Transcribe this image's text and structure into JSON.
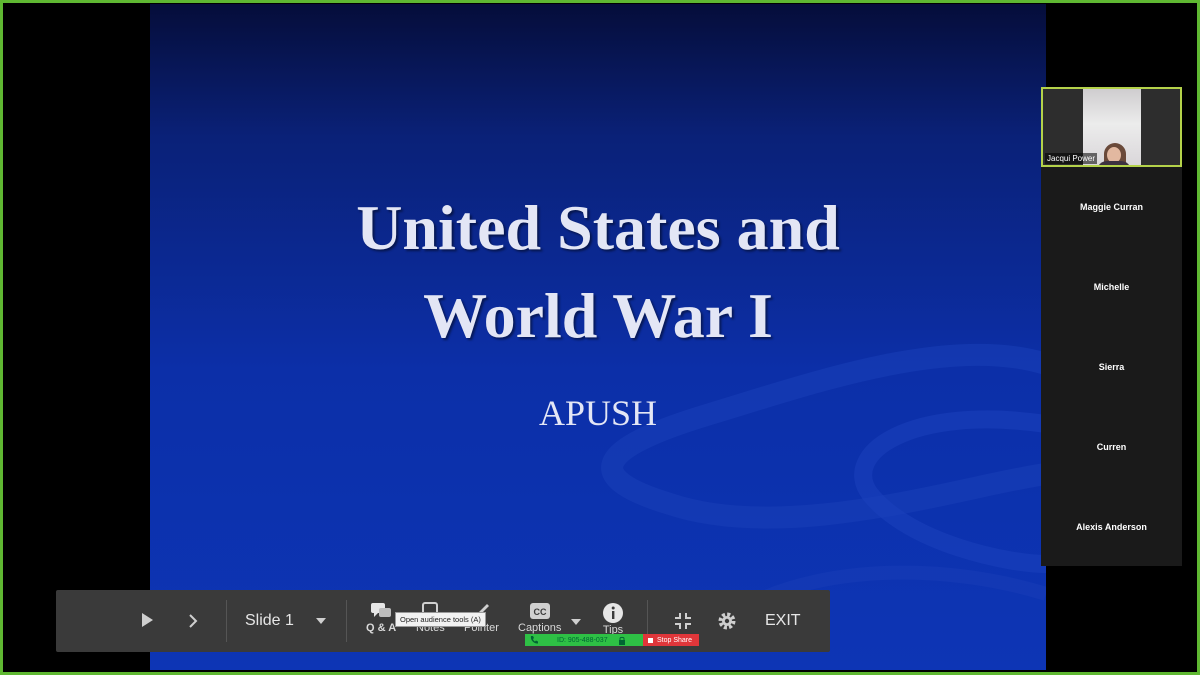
{
  "slide": {
    "title_line1": "United States and",
    "title_line2": "World War I",
    "subtitle": "APUSH"
  },
  "participants": {
    "video": {
      "name": "Jacqui Power"
    },
    "names": [
      "Maggie Curran",
      "Michelle",
      "Sierra",
      "Curren",
      "Alexis Anderson"
    ]
  },
  "toolbar": {
    "slide_label": "Slide 1",
    "qa_label": "Q & A",
    "notes_label": "Notes",
    "pointer_label": "Pointer",
    "captions_label": "Captions",
    "tips_label": "Tips",
    "exit_label": "EXIT",
    "tooltip": "Open audience tools (A)"
  },
  "meeting": {
    "id_text": "ID: 905-488-037",
    "stop_share_label": "Stop Share"
  },
  "colors": {
    "frame": "#5fb832",
    "share_bar": "#2ec045",
    "stop_share": "#e0363a",
    "active_speaker": "#b4d24a"
  }
}
